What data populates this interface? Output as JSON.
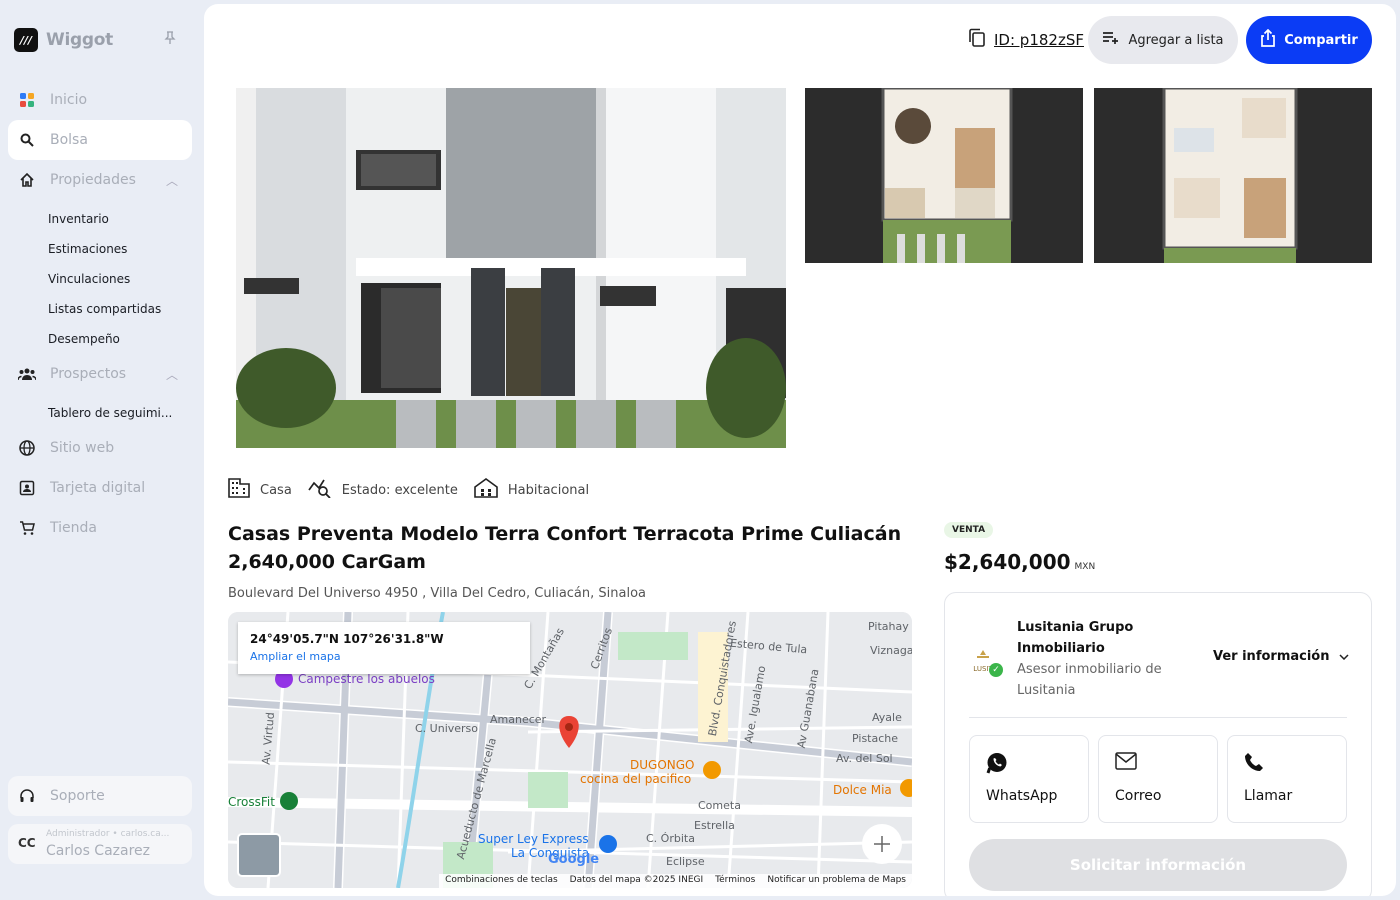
{
  "brand": {
    "name": "Wiggot"
  },
  "nav": {
    "home": "Inicio",
    "bolsa": "Bolsa",
    "propiedades": "Propiedades",
    "prop_sub": [
      "Inventario",
      "Estimaciones",
      "Vinculaciones",
      "Listas compartidas",
      "Desempeño"
    ],
    "prospectos": "Prospectos",
    "prosp_sub": [
      "Tablero de seguimi..."
    ],
    "sitio": "Sitio web",
    "tarjeta": "Tarjeta digital",
    "tienda": "Tienda",
    "soporte": "Soporte"
  },
  "user": {
    "initials": "CC",
    "role": "Administrador  •  carlos.ca...",
    "name": "Carlos Cazarez"
  },
  "header": {
    "id_label": "ID: p182zSF",
    "add_list": "Agregar a lista",
    "share": "Compartir"
  },
  "tags": {
    "type": "Casa",
    "state": "Estado: excelente",
    "use": "Habitacional"
  },
  "listing": {
    "title": "Casas Preventa Modelo Terra Confort Terracota Prime Culiacán 2,640,000 CarGam",
    "address": "Boulevard Del Universo 4950 , Villa Del Cedro, Culiacán, Sinaloa",
    "badge": "VENTA",
    "price": "$2,640,000",
    "currency": "MXN"
  },
  "map": {
    "coords": "24°49'05.7\"N 107°26'31.8\"W",
    "expand": "Ampliar el mapa",
    "footer": [
      "Combinaciones de teclas",
      "Datos del mapa ©2025 INEGI",
      "Términos",
      "Notificar un problema de Maps"
    ],
    "labels": {
      "campestre": "Campestre los abuelos",
      "universo": "C. Universo",
      "amanecer": "Amanecer",
      "cerritos": "Cerritos",
      "estero": "Estero de Tula",
      "pitahaya": "Pitahay",
      "viznaga": "Viznaga",
      "ayale": "Ayale",
      "pistache": "Pistache",
      "delsol": "Av. del Sol",
      "dugongo": "DUGONGO",
      "cocina": "cocina del pacifico",
      "dolce": "Dolce Mia",
      "cometa": "Cometa",
      "estrella": "Estrella",
      "orbita": "C. Órbita",
      "eclipse": "Eclipse",
      "superley": "Super Ley Express",
      "conquista": "La Conquista",
      "crossfit": "CrossFit",
      "conquistadores": "Blvd. Conquistadores",
      "igualamo": "Ave. Igualamo",
      "guanabana": "Av Guanabana",
      "marcella": "Acueducto de Marcella",
      "virtud": "Av. Virtud",
      "montanas": "C. Montañas",
      "google": "Google"
    }
  },
  "agent": {
    "company": "Lusitania Grupo Inmobiliario",
    "role": "Asesor inmobiliario de Lusitania",
    "logo_text": "LUSIT",
    "more": "Ver información",
    "whatsapp": "WhatsApp",
    "email": "Correo",
    "call": "Llamar",
    "request": "Solicitar información"
  },
  "colors": {
    "primary": "#0b3cf5",
    "sidebar_bg": "#e9edf5",
    "badge_bg": "#e9f6e6",
    "map_pin": "#ea4335"
  }
}
